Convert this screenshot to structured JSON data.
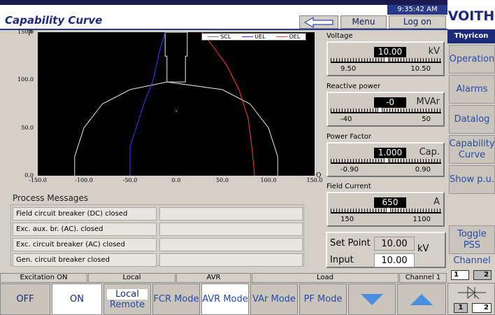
{
  "header": {
    "title": "Capability Curve",
    "menu_label": "Menu",
    "logon_label": "Log on",
    "clock": "9:35:42 AM",
    "logo": "VOITH"
  },
  "sidebar": {
    "title": "Thyricon",
    "items": [
      {
        "label": "Operation"
      },
      {
        "label": "Alarms"
      },
      {
        "label": "Datalog"
      },
      {
        "label": "Capability Curve"
      },
      {
        "label": "Show p.u."
      },
      {
        "label": "Toggle PSS"
      }
    ],
    "channel_label": "Channel",
    "channel_options": [
      "1",
      "2"
    ]
  },
  "chart_data": {
    "type": "line",
    "title": "",
    "xlabel": "Q",
    "ylabel": "P",
    "xlim": [
      -150,
      150
    ],
    "ylim": [
      0,
      150
    ],
    "x_ticks": [
      "-150.0",
      "-100.0",
      "-50.0",
      "0.0",
      "50.0",
      "100.0",
      "150.0"
    ],
    "y_ticks": [
      "0.0",
      "50.0",
      "100.0",
      "150.0"
    ],
    "legend": [
      "SCL",
      "UEL",
      "OEL"
    ],
    "legend_position": "top-right",
    "series_colors": {
      "SCL": "#e8e8e8",
      "UEL": "#3a3aff",
      "OEL": "#ff3a3a"
    },
    "series": [
      {
        "name": "SCL",
        "points": [
          [
            -110,
            0
          ],
          [
            -110,
            20
          ],
          [
            -100,
            50
          ],
          [
            -80,
            75
          ],
          [
            -50,
            90
          ],
          [
            -10,
            98
          ],
          [
            10,
            98
          ],
          [
            10,
            125
          ],
          [
            12,
            125
          ],
          [
            12,
            150
          ],
          [
            -12,
            150
          ],
          [
            -12,
            125
          ],
          [
            -10,
            125
          ],
          [
            -10,
            98
          ],
          [
            50,
            90
          ],
          [
            80,
            75
          ],
          [
            100,
            50
          ],
          [
            110,
            20
          ],
          [
            110,
            0
          ]
        ]
      },
      {
        "name": "UEL",
        "points": [
          [
            -50,
            0
          ],
          [
            -50,
            30
          ],
          [
            -45,
            45
          ],
          [
            -35,
            75
          ],
          [
            -25,
            100
          ],
          [
            -18,
            130
          ],
          [
            -12,
            150
          ]
        ]
      },
      {
        "name": "OEL",
        "points": [
          [
            85,
            0
          ],
          [
            82,
            30
          ],
          [
            78,
            60
          ],
          [
            68,
            90
          ],
          [
            55,
            115
          ],
          [
            40,
            135
          ],
          [
            28,
            150
          ]
        ]
      }
    ],
    "operating_point": [
      0,
      68
    ]
  },
  "process_messages": {
    "title": "Process Messages",
    "items": [
      "Field circuit breaker (DC) closed",
      "Exc. aux. br. (AC). closed",
      "Exc. circuit breaker (AC) closed",
      "Gen. circuit breaker closed"
    ]
  },
  "gauges": [
    {
      "label": "Voltage",
      "value": "10.00",
      "unit": "kV",
      "min": "9.50",
      "max": "10.50",
      "fraction": 0.5
    },
    {
      "label": "Reactive power",
      "value": "-0",
      "unit": "MVAr",
      "min": "-40",
      "max": "50",
      "fraction": 0.44
    },
    {
      "label": "Power Factor",
      "value": "1.000",
      "unit": "Cap.",
      "min": "-0.90",
      "max": "0.90",
      "fraction": 0.5
    },
    {
      "label": "Field Current",
      "value": "650",
      "unit": "A",
      "min": "150",
      "max": "1100",
      "fraction": 0.52
    }
  ],
  "setpoint": {
    "setpoint_label": "Set Point",
    "setpoint_value": "10.00",
    "input_label": "Input",
    "input_value": "10.00",
    "unit": "kV"
  },
  "status_bar": [
    "Excitation ON",
    "Local",
    "AVR",
    "Load",
    "Channel 1"
  ],
  "bottom_buttons": {
    "off": "OFF",
    "on": "ON",
    "local": "Local",
    "remote": "Remote",
    "fcr": "FCR Mode",
    "avr": "AVR Mode",
    "var": "VAr Mode",
    "pf": "PF Mode",
    "channel_toggle": [
      "1",
      "2"
    ]
  }
}
